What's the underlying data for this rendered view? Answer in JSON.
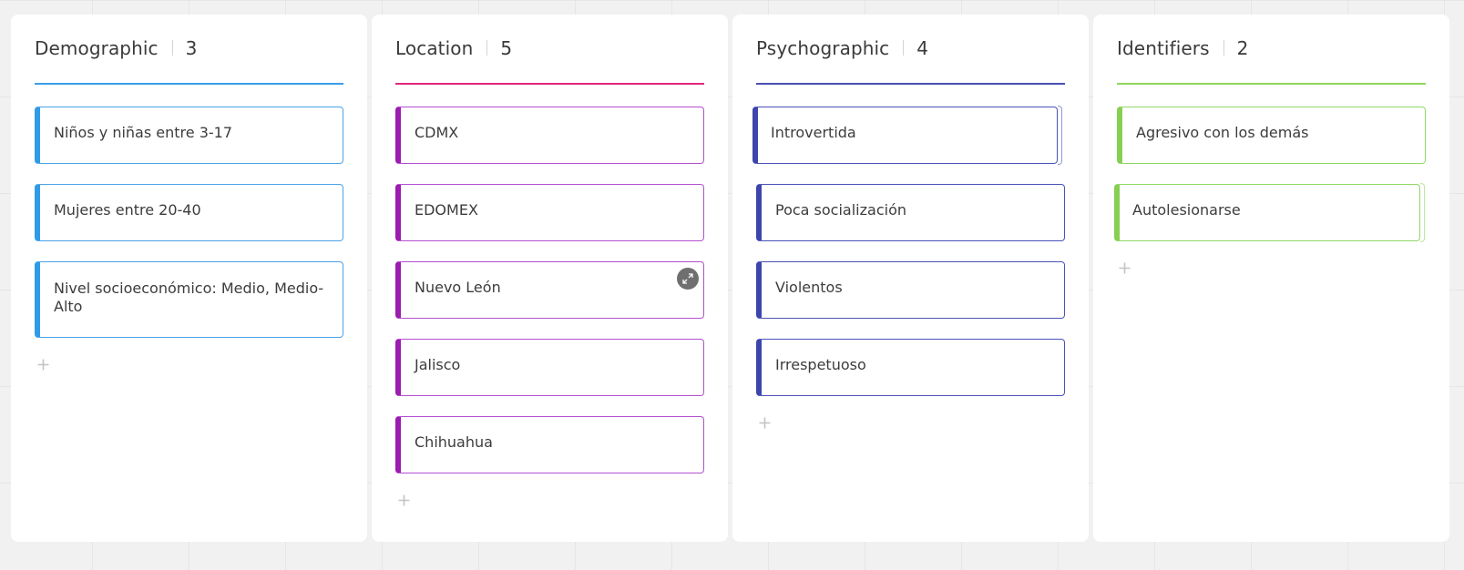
{
  "columns": [
    {
      "id": "demographic",
      "title": "Demographic",
      "count": "3",
      "accent": "#2f9be8",
      "cards": [
        {
          "text": "Niños y niñas entre 3-17"
        },
        {
          "text": "Mujeres entre 20-40"
        },
        {
          "text": "Nivel socioeconómico: Medio, Medio-Alto"
        }
      ],
      "add_icon": "plus-icon"
    },
    {
      "id": "location",
      "title": "Location",
      "count": "5",
      "accent": "#9c1bb0",
      "header_line": "#e0287a",
      "cards": [
        {
          "text": "CDMX"
        },
        {
          "text": "EDOMEX"
        },
        {
          "text": "Nuevo León",
          "hover_icon": "expand-icon"
        },
        {
          "text": "Jalisco"
        },
        {
          "text": "Chihuahua"
        }
      ],
      "add_icon": "plus-icon"
    },
    {
      "id": "psychographic",
      "title": "Psychographic",
      "count": "4",
      "accent": "#3d45ad",
      "cards": [
        {
          "text": "Introvertida"
        },
        {
          "text": "Poca socialización"
        },
        {
          "text": "Violentos"
        },
        {
          "text": "Irrespetuoso"
        }
      ],
      "add_icon": "plus-icon"
    },
    {
      "id": "identifiers",
      "title": "Identifiers",
      "count": "2",
      "accent": "#86cf52",
      "cards": [
        {
          "text": "Agresivo con los demás"
        },
        {
          "text": "Autolesionarse"
        }
      ],
      "add_icon": "plus-icon"
    }
  ]
}
